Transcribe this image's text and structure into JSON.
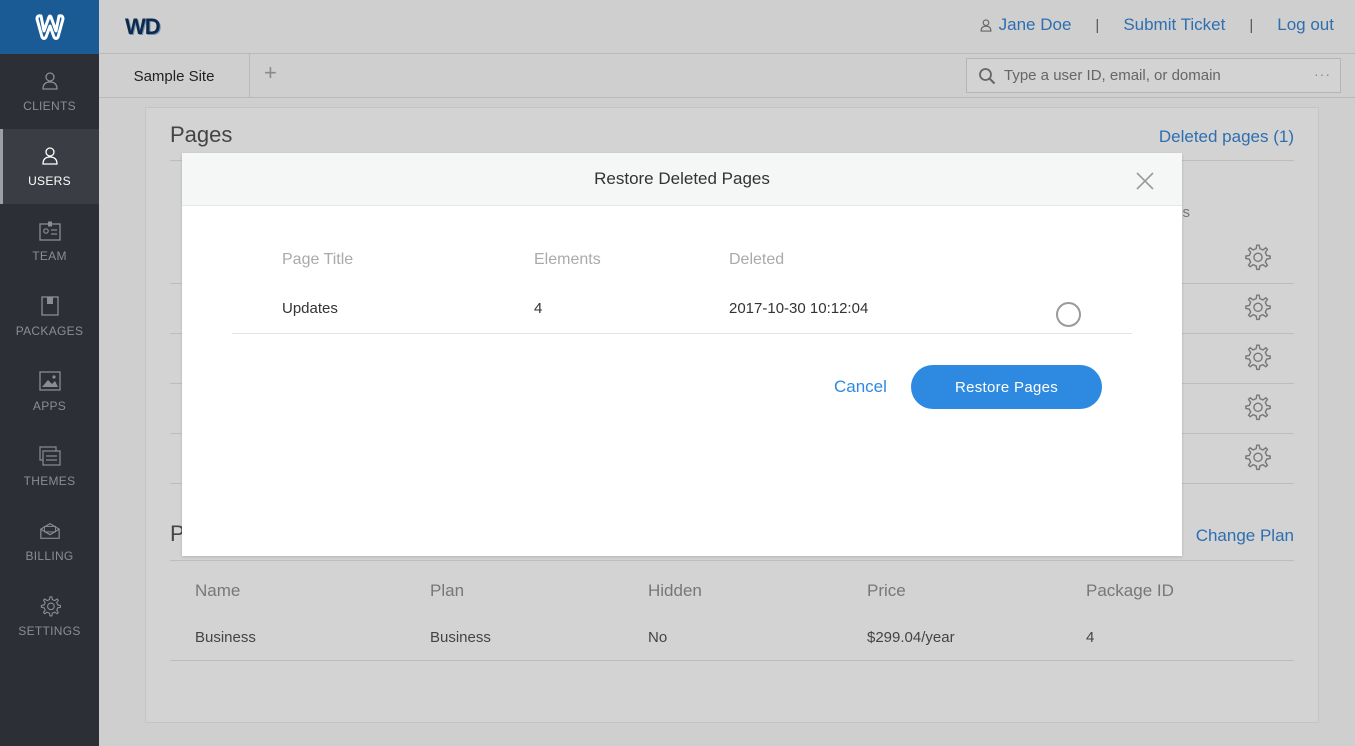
{
  "brand": {
    "logo_text": "WD"
  },
  "colors": {
    "accent": "#2d8ae0",
    "sidebar_bg": "#2c3036",
    "logo_bg": "#1a5a95",
    "link": "#2d6fb0"
  },
  "sidebar": {
    "items": [
      {
        "label": "CLIENTS",
        "icon": "user-icon",
        "active": false
      },
      {
        "label": "USERS",
        "icon": "user-icon",
        "active": true
      },
      {
        "label": "TEAM",
        "icon": "badge-icon",
        "active": false
      },
      {
        "label": "PACKAGES",
        "icon": "package-icon",
        "active": false
      },
      {
        "label": "APPS",
        "icon": "image-icon",
        "active": false
      },
      {
        "label": "THEMES",
        "icon": "layers-icon",
        "active": false
      },
      {
        "label": "BILLING",
        "icon": "envelope-icon",
        "active": false
      },
      {
        "label": "SETTINGS",
        "icon": "gear-icon",
        "active": false
      }
    ]
  },
  "header": {
    "user_name": "Jane Doe",
    "separator": "|",
    "submit_ticket": "Submit Ticket",
    "logout": "Log out"
  },
  "tabs": {
    "site_tab": "Sample Site",
    "add_tab": "+"
  },
  "search": {
    "placeholder": "Type a user ID, email, or domain",
    "more": "···"
  },
  "pages_section": {
    "title": "Pages",
    "deleted_link": "Deleted pages (1)",
    "partial_column_text": "s"
  },
  "plan_section": {
    "title_partial": "P",
    "change_plan": "Change Plan",
    "columns": [
      "Name",
      "Plan",
      "Hidden",
      "Price",
      "Package ID"
    ],
    "rows": [
      [
        "Business",
        "Business",
        "No",
        "$299.04/year",
        "4"
      ]
    ]
  },
  "modal": {
    "title": "Restore Deleted Pages",
    "columns": [
      "Page Title",
      "Elements",
      "Deleted"
    ],
    "rows": [
      {
        "title": "Updates",
        "elements": "4",
        "deleted": "2017-10-30 10:12:04",
        "selected": false
      }
    ],
    "cancel_label": "Cancel",
    "restore_label": "Restore Pages"
  }
}
